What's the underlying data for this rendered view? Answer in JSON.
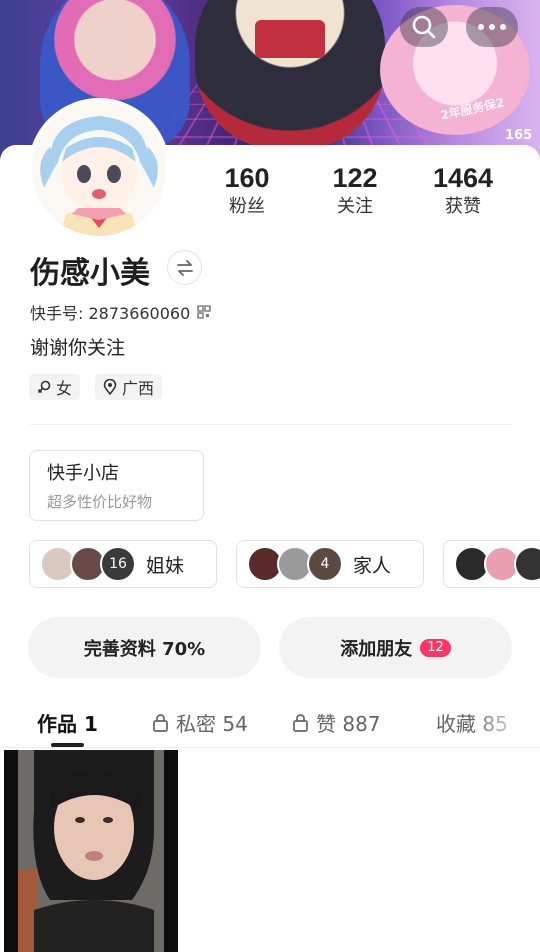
{
  "header": {
    "search_icon": "search-icon",
    "more_icon": "more-icon",
    "banner_text": "2年服务保2",
    "banner_num": "165"
  },
  "profile": {
    "name": "伤感小美",
    "kwai_id": "快手号: 2873660060",
    "bio": "谢谢你关注",
    "tags": [
      {
        "icon": "female-icon",
        "label": "女"
      },
      {
        "icon": "location-icon",
        "label": "广西"
      }
    ]
  },
  "stats": [
    {
      "value": "160",
      "label": "粉丝"
    },
    {
      "value": "122",
      "label": "关注"
    },
    {
      "value": "1464",
      "label": "获赞"
    }
  ],
  "shop": {
    "title": "快手小店",
    "subtitle": "超多性价比好物"
  },
  "groups": [
    {
      "label": "姐妹",
      "count": "16"
    },
    {
      "label": "家人",
      "count": "4"
    }
  ],
  "actions": {
    "complete_profile": "完善资料 70%",
    "add_friends": "添加朋友",
    "add_friends_badge": "12"
  },
  "tabs": [
    {
      "label": "作品 1",
      "locked": false,
      "active": true
    },
    {
      "label": "私密 54",
      "locked": true,
      "active": false
    },
    {
      "label": "赞 887",
      "locked": true,
      "active": false
    },
    {
      "label": "收藏 85",
      "locked": false,
      "active": false
    }
  ],
  "colors": {
    "badge": "#fe3666",
    "pill_bg": "#f3f3f3"
  }
}
